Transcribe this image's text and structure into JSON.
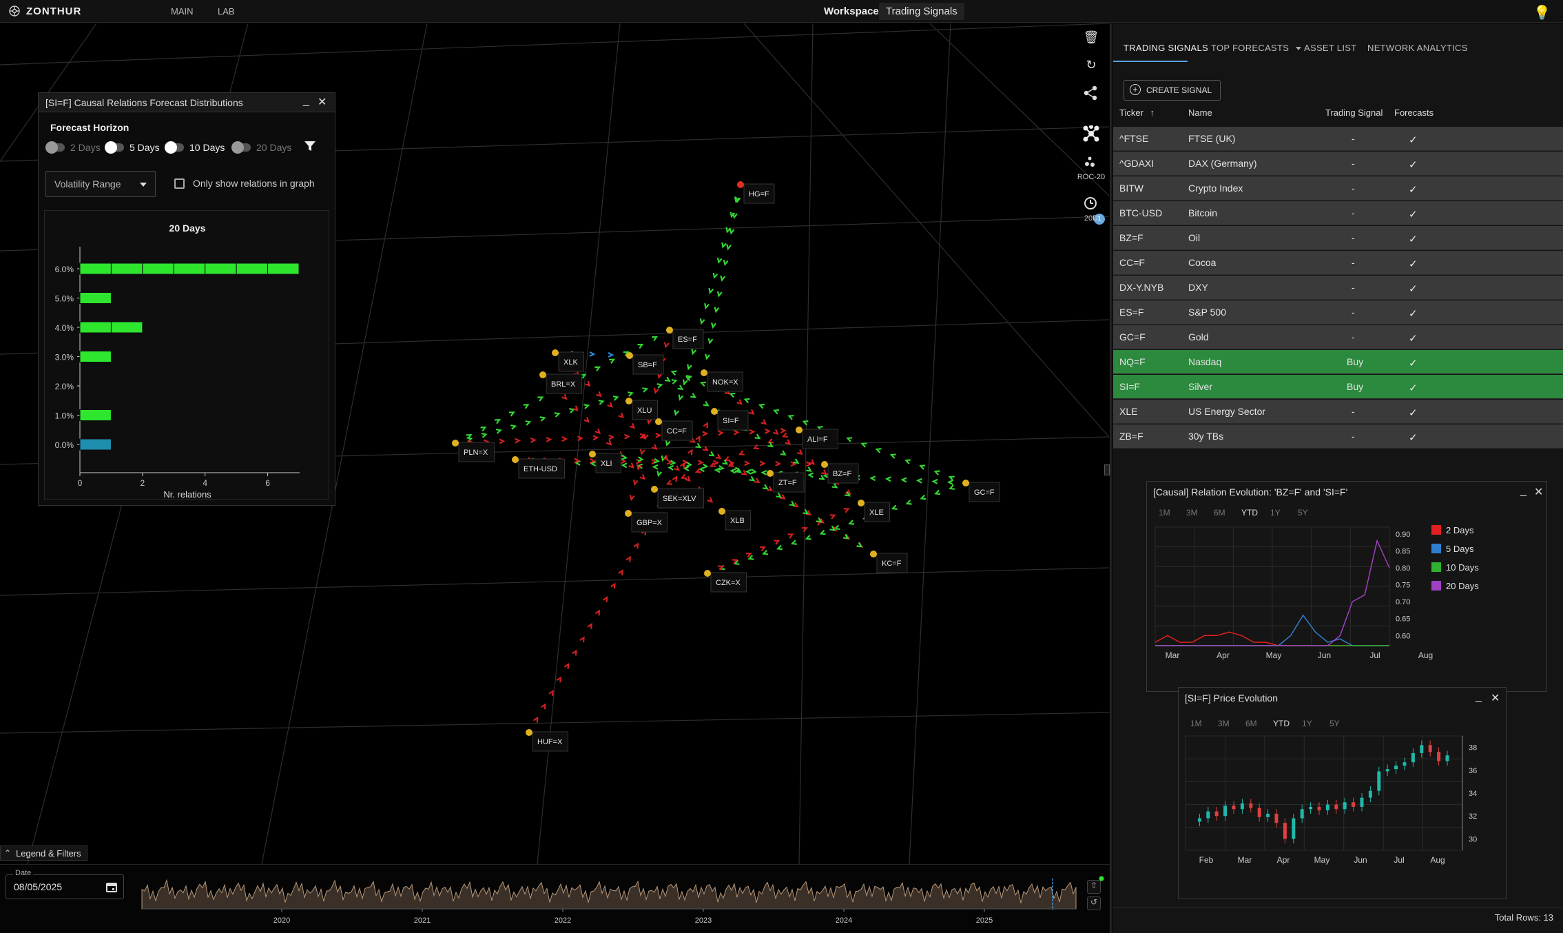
{
  "app": {
    "brand": "ZONTHUR",
    "nav": [
      "MAIN",
      "LAB"
    ],
    "workspace_label": "Workspace:",
    "workspace_value": "Trading Signals"
  },
  "graph": {
    "toolbar_labels": {
      "roc": "ROC-20",
      "days": "20D",
      "badge": "1"
    },
    "nodes": [
      "HG=F",
      "ES=F",
      "XLK",
      "SB=F",
      "BRL=X",
      "NOK=X",
      "XLU",
      "SI=F",
      "CC=F",
      "PLN=X",
      "ALI=F",
      "ETH-USD",
      "XLI",
      "BZ=F",
      "ZT=F",
      "GC=F",
      "SEK=XLV",
      "XLB",
      "XLE",
      "GBP=X",
      "KC=F",
      "CZK=X",
      "HUF=X"
    ]
  },
  "dist_panel": {
    "title": "[SI=F] Causal Relations Forecast Distributions",
    "horizon_title": "Forecast Horizon",
    "toggles": [
      {
        "label": "2 Days",
        "on": false
      },
      {
        "label": "5 Days",
        "on": true
      },
      {
        "label": "10 Days",
        "on": true
      },
      {
        "label": "20 Days",
        "on": false
      }
    ],
    "volatility_select": "Volatility Range",
    "only_show_label": "Only show relations in graph"
  },
  "chart_data": [
    {
      "type": "bar",
      "orientation": "horizontal",
      "title": "20 Days",
      "xlabel": "Nr. relations",
      "categories": [
        "6.0%",
        "5.0%",
        "4.0%",
        "3.0%",
        "2.0%",
        "1.0%",
        "0.0%"
      ],
      "values": [
        7,
        1,
        2,
        1,
        0,
        1,
        1
      ],
      "bar_colors": [
        "#2ee62e",
        "#2ee62e",
        "#2ee62e",
        "#2ee62e",
        "#2ee62e",
        "#2ee62e",
        "#1f8fb0"
      ],
      "xticks": [
        "0",
        "2",
        "4",
        "6"
      ],
      "xlim": [
        0,
        7
      ]
    },
    {
      "type": "line",
      "title": "[Causal] Relation Evolution: 'BZ=F' and 'SI=F'",
      "x": [
        "Mar",
        "Apr",
        "May",
        "Jun",
        "Jul",
        "Aug"
      ],
      "yticks": [
        "0.90",
        "0.85",
        "0.80",
        "0.75",
        "0.70",
        "0.65",
        "0.60"
      ],
      "ylim": [
        0.57,
        0.92
      ],
      "series": [
        {
          "name": "2 Days",
          "color": "#e02020",
          "values": [
            0.58,
            0.6,
            0.58,
            0.58,
            0.6,
            0.6,
            0.61,
            0.6,
            0.58,
            0.58,
            0.57,
            0.57,
            0.57,
            0.57,
            0.57,
            0.57,
            0.57,
            0.57,
            0.57,
            0.57
          ]
        },
        {
          "name": "5 Days",
          "color": "#2f7fd0",
          "values": [
            0.57,
            0.57,
            0.57,
            0.57,
            0.57,
            0.57,
            0.57,
            0.57,
            0.57,
            0.57,
            0.57,
            0.6,
            0.66,
            0.61,
            0.58,
            0.59,
            0.57,
            0.57,
            0.57,
            0.57
          ]
        },
        {
          "name": "10 Days",
          "color": "#2fb02f",
          "values": [
            0.57,
            0.57,
            0.57,
            0.57,
            0.57,
            0.57,
            0.57,
            0.57,
            0.57,
            0.57,
            0.57,
            0.57,
            0.57,
            0.57,
            0.57,
            0.57,
            0.57,
            0.57,
            0.57,
            0.57
          ]
        },
        {
          "name": "20 Days",
          "color": "#a040c0",
          "values": [
            0.57,
            0.57,
            0.57,
            0.57,
            0.57,
            0.57,
            0.57,
            0.57,
            0.57,
            0.57,
            0.57,
            0.57,
            0.57,
            0.57,
            0.57,
            0.6,
            0.7,
            0.72,
            0.88,
            0.8
          ]
        }
      ]
    },
    {
      "type": "candlestick",
      "title": "[SI=F] Price Evolution",
      "x": [
        "Feb",
        "Mar",
        "Apr",
        "May",
        "Jun",
        "Jul",
        "Aug"
      ],
      "yticks": [
        "38",
        "36",
        "34",
        "32",
        "30"
      ],
      "ylim": [
        29,
        39
      ],
      "values": [
        31.5,
        31.8,
        32.4,
        32.0,
        32.9,
        32.6,
        33.1,
        32.7,
        31.9,
        32.2,
        31.4,
        30.0,
        31.8,
        32.6,
        32.8,
        32.5,
        33.0,
        32.6,
        33.2,
        32.8,
        33.6,
        34.2,
        35.9,
        36.1,
        36.4,
        36.7,
        37.5,
        38.2,
        37.6,
        36.8,
        37.3
      ]
    }
  ],
  "timeline": {
    "date_label": "Date",
    "date_value": "08/05/2025",
    "years": [
      "2020",
      "2021",
      "2022",
      "2023",
      "2024",
      "2025"
    ]
  },
  "legend_button": "Legend & Filters",
  "right_panel": {
    "tabs": [
      "TRADING SIGNALS",
      "TOP FORECASTS",
      "ASSET LIST",
      "NETWORK ANALYTICS"
    ],
    "create_signal": "CREATE SIGNAL",
    "columns": [
      "Ticker",
      "Name",
      "Trading Signal",
      "Forecasts"
    ],
    "rows": [
      {
        "ticker": "^FTSE",
        "name": "FTSE (UK)",
        "signal": "-",
        "forecast": "✓",
        "buy": false
      },
      {
        "ticker": "^GDAXI",
        "name": "DAX (Germany)",
        "signal": "-",
        "forecast": "✓",
        "buy": false
      },
      {
        "ticker": "BITW",
        "name": "Crypto Index",
        "signal": "-",
        "forecast": "✓",
        "buy": false
      },
      {
        "ticker": "BTC-USD",
        "name": "Bitcoin",
        "signal": "-",
        "forecast": "✓",
        "buy": false
      },
      {
        "ticker": "BZ=F",
        "name": "Oil",
        "signal": "-",
        "forecast": "✓",
        "buy": false
      },
      {
        "ticker": "CC=F",
        "name": "Cocoa",
        "signal": "-",
        "forecast": "✓",
        "buy": false
      },
      {
        "ticker": "DX-Y.NYB",
        "name": "DXY",
        "signal": "-",
        "forecast": "✓",
        "buy": false
      },
      {
        "ticker": "ES=F",
        "name": "S&P 500",
        "signal": "-",
        "forecast": "✓",
        "buy": false
      },
      {
        "ticker": "GC=F",
        "name": "Gold",
        "signal": "-",
        "forecast": "✓",
        "buy": false
      },
      {
        "ticker": "NQ=F",
        "name": "Nasdaq",
        "signal": "Buy",
        "forecast": "✓",
        "buy": true
      },
      {
        "ticker": "SI=F",
        "name": "Silver",
        "signal": "Buy",
        "forecast": "✓",
        "buy": true
      },
      {
        "ticker": "XLE",
        "name": "US Energy Sector",
        "signal": "-",
        "forecast": "✓",
        "buy": false
      },
      {
        "ticker": "ZB=F",
        "name": "30y TBs",
        "signal": "-",
        "forecast": "✓",
        "buy": false
      }
    ],
    "total_rows": "Total Rows: 13"
  },
  "relation_panel": {
    "title": "[Causal] Relation Evolution: 'BZ=F' and 'SI=F'",
    "periods": [
      "1M",
      "3M",
      "6M",
      "YTD",
      "1Y",
      "5Y"
    ],
    "active_period": "YTD"
  },
  "price_panel": {
    "title": "[SI=F] Price Evolution",
    "periods": [
      "1M",
      "3M",
      "6M",
      "YTD",
      "1Y",
      "5Y"
    ],
    "active_period": "YTD"
  },
  "colors": {
    "accent": "#5aa0e0",
    "buy_row": "#2b8a3e",
    "up_green": "#2ee62e",
    "down_red": "#d42020"
  }
}
